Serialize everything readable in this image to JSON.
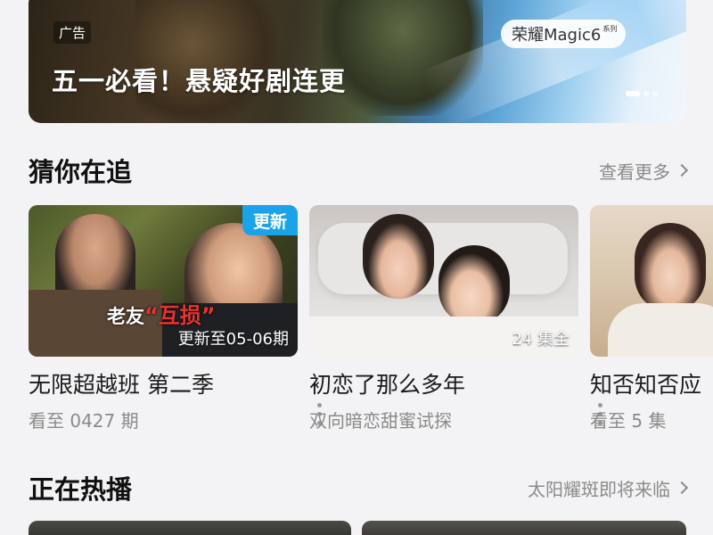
{
  "banner": {
    "ad_tag": "广告",
    "title": "五一必看！悬疑好剧连更",
    "brand_text": "荣耀Magic6",
    "brand_suffix": "系列",
    "page_indicator": {
      "active": 1,
      "total": 3
    }
  },
  "sections": {
    "following": {
      "title": "猜你在追",
      "link": "查看更多",
      "items": [
        {
          "title": "无限超越班 第二季",
          "subtitle": "看至 0427 期",
          "badge": "更新",
          "caption_prefix": "老友",
          "caption_quoted": "“互损”",
          "note": "更新至05-06期"
        },
        {
          "title": "初恋了那么多年",
          "subtitle": "双向暗恋甜蜜试探",
          "note": "24 集全"
        },
        {
          "title": "知否知否应",
          "subtitle": "看至 5 集"
        }
      ]
    },
    "hot": {
      "title": "正在热播",
      "link": "太阳耀斑即将来临"
    }
  },
  "colors": {
    "badge_blue": "#1aa3e8",
    "caption_red": "#e8332f",
    "muted": "#8a8a8a"
  }
}
